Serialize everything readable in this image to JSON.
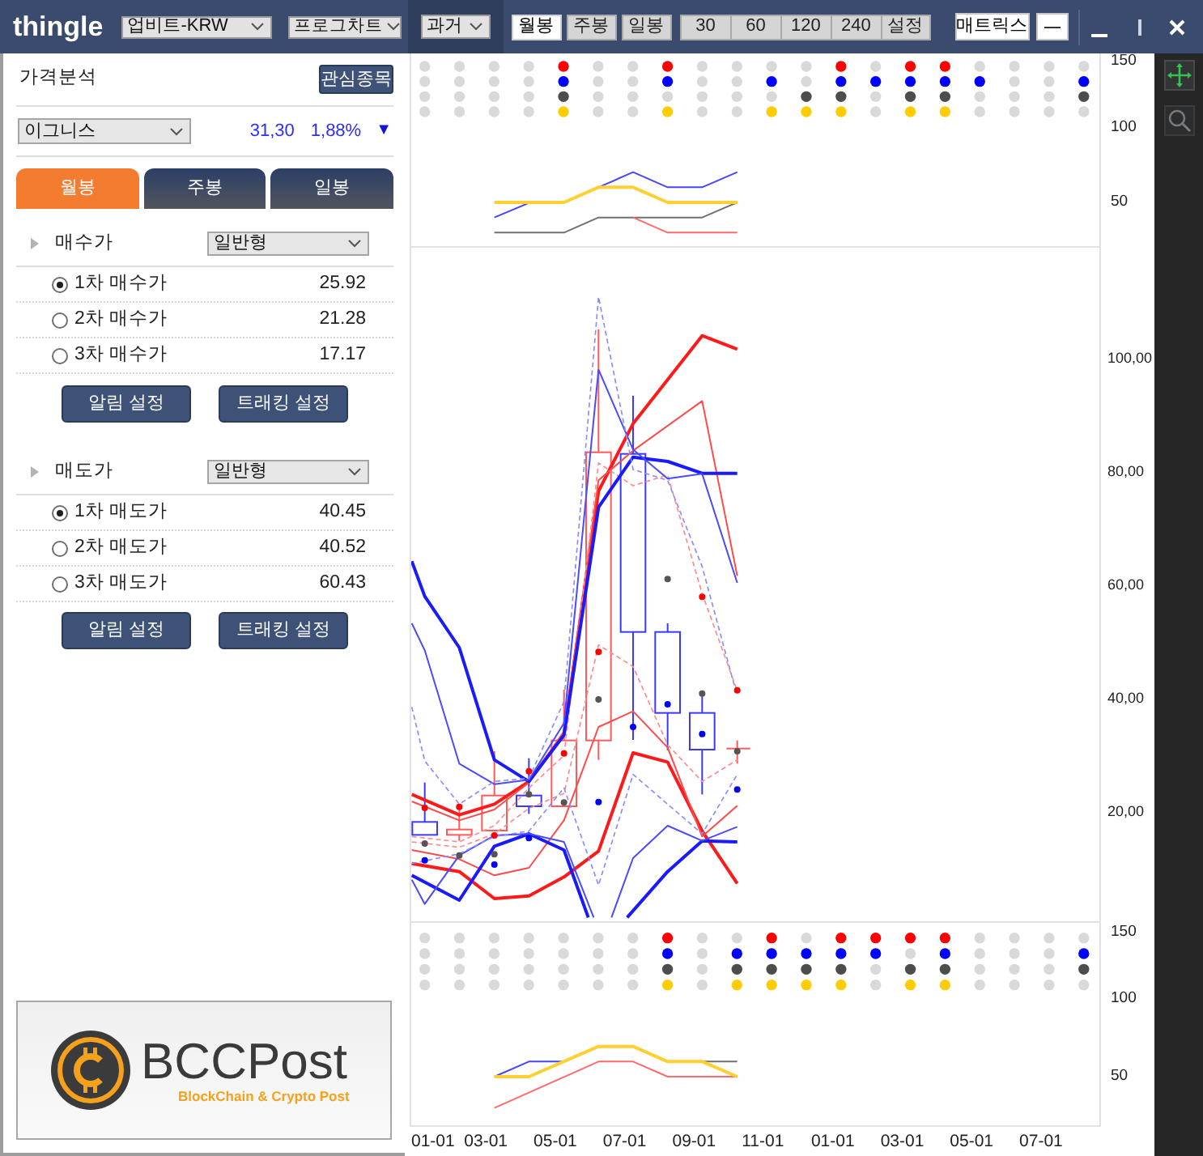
{
  "header": {
    "logo": "thingle",
    "exchange_dropdown": "업비트-KRW",
    "chart_dropdown": "프로그차트",
    "range_dropdown": "과거",
    "period_tabs": [
      {
        "label": "월봉",
        "selected": true
      },
      {
        "label": "주봉",
        "selected": false
      },
      {
        "label": "일봉",
        "selected": false
      }
    ],
    "interval_buttons": [
      {
        "label": "30",
        "selected": false
      },
      {
        "label": "60",
        "selected": false
      },
      {
        "label": "120",
        "selected": false
      },
      {
        "label": "240",
        "selected": false
      },
      {
        "label": "설정",
        "selected": false
      }
    ],
    "matrix_button": "매트릭스"
  },
  "left_panel": {
    "title": "가격분석",
    "watchlist_button": "관심종목",
    "coin_dropdown": "이그니스",
    "price": "31,30",
    "change": "1,88%",
    "change_arrow": "▼",
    "tabs": [
      {
        "label": "월봉",
        "selected": true
      },
      {
        "label": "주봉",
        "selected": false
      },
      {
        "label": "일봉",
        "selected": false
      }
    ],
    "sections": [
      {
        "label": "매수가",
        "mode_dropdown": "일반형",
        "options": [
          {
            "label": "1차 매수가",
            "value": "25.92",
            "selected": true
          },
          {
            "label": "2차 매수가",
            "value": "21.28",
            "selected": false
          },
          {
            "label": "3차 매수가",
            "value": "17.17",
            "selected": false
          }
        ],
        "buttons": [
          "알림 설정",
          "트래킹 설정"
        ]
      },
      {
        "label": "매도가",
        "mode_dropdown": "일반형",
        "options": [
          {
            "label": "1차 매도가",
            "value": "40.45",
            "selected": true
          },
          {
            "label": "2차 매도가",
            "value": "40.52",
            "selected": false
          },
          {
            "label": "3차 매도가",
            "value": "60.43",
            "selected": false
          }
        ],
        "buttons": [
          "알림 설정",
          "트래킹 설정"
        ]
      }
    ],
    "banner": {
      "brand": "BCCPost",
      "tagline": "BlockChain & Crypto Post"
    }
  },
  "chart": {
    "top_panel": {
      "y_axis_labels": [
        "150",
        "100",
        "50"
      ],
      "signal_rows": [
        {
          "color": "#ff0000",
          "on": [
            false,
            false,
            false,
            false,
            true,
            false,
            false,
            true,
            false,
            false,
            false,
            false,
            true,
            false,
            true,
            true,
            false,
            false,
            false,
            false
          ]
        },
        {
          "color": "#0000ff",
          "on": [
            false,
            false,
            false,
            false,
            true,
            false,
            false,
            true,
            false,
            false,
            true,
            false,
            true,
            true,
            true,
            true,
            true,
            false,
            false,
            true
          ]
        },
        {
          "color": "#4d4d4d",
          "on": [
            false,
            false,
            false,
            false,
            true,
            false,
            false,
            false,
            false,
            false,
            false,
            true,
            true,
            false,
            true,
            true,
            false,
            false,
            false,
            true
          ]
        },
        {
          "color": "#ffcc00",
          "on": [
            false,
            false,
            false,
            false,
            true,
            false,
            false,
            true,
            false,
            false,
            true,
            true,
            true,
            false,
            true,
            true,
            false,
            false,
            false,
            false
          ]
        }
      ]
    },
    "main_panel": {
      "y_axis_labels": [
        "100,00",
        "80,00",
        "60,00",
        "40,00",
        "20,00"
      ]
    },
    "bottom_panel": {
      "y_axis_labels": [
        "150",
        "100",
        "50"
      ],
      "signal_rows": [
        {
          "color": "#ff0000",
          "on": [
            false,
            false,
            false,
            false,
            false,
            false,
            false,
            true,
            false,
            false,
            true,
            false,
            true,
            true,
            true,
            true,
            false,
            false,
            false,
            false
          ]
        },
        {
          "color": "#0000ff",
          "on": [
            false,
            false,
            false,
            false,
            false,
            false,
            false,
            true,
            false,
            true,
            true,
            true,
            true,
            true,
            false,
            true,
            false,
            false,
            false,
            true
          ]
        },
        {
          "color": "#4d4d4d",
          "on": [
            false,
            false,
            false,
            false,
            false,
            false,
            false,
            true,
            false,
            true,
            true,
            true,
            true,
            false,
            true,
            true,
            false,
            false,
            false,
            true
          ]
        },
        {
          "color": "#ffcc00",
          "on": [
            false,
            false,
            false,
            false,
            false,
            false,
            false,
            true,
            false,
            true,
            true,
            true,
            true,
            false,
            true,
            true,
            false,
            false,
            false,
            false
          ]
        }
      ]
    },
    "x_axis_labels": [
      "01-01",
      "03-01",
      "05-01",
      "07-01",
      "09-01",
      "11-01",
      "01-01",
      "03-01",
      "05-01",
      "07-01"
    ]
  }
}
